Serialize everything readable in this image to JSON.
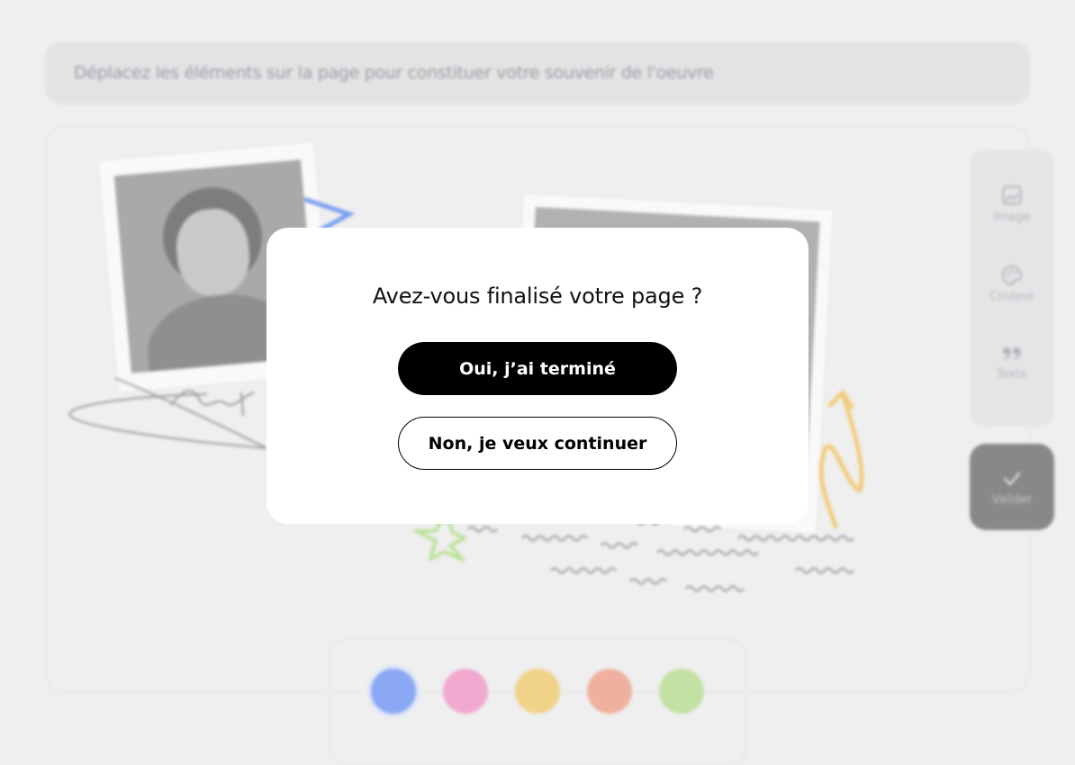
{
  "instruction": {
    "text": "Déplacez les éléments  sur la page pour constituer votre souvenir de l'oeuvre"
  },
  "toolbar": {
    "image_label": "Image",
    "color_label": "Couleur",
    "text_label": "Texte",
    "validate_label": "Valider",
    "icons": {
      "image": "image-icon",
      "color": "palette-icon",
      "text": "quote-icon",
      "validate": "check-icon"
    }
  },
  "palette": {
    "colors": [
      "#8aa8f3",
      "#f1a8cf",
      "#f0d388",
      "#f0b09f",
      "#c2e1a2"
    ],
    "selected_index": 0
  },
  "modal": {
    "title": "Avez-vous finalisé votre page ?",
    "confirm_label": "Oui, j’ai terminé",
    "continue_label": "Non, je veux continuer"
  },
  "colors": {
    "overlay_bg": "#efefef",
    "modal_bg": "#ffffff",
    "primary_button": "#000000",
    "validate_button": "#888888"
  }
}
